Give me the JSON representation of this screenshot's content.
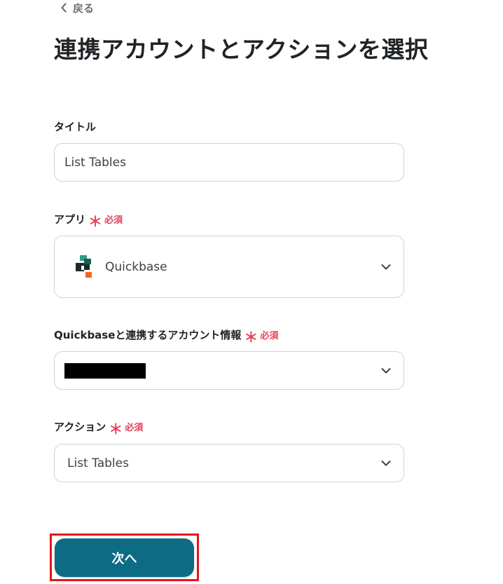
{
  "nav": {
    "back_label": "戻る"
  },
  "page": {
    "title": "連携アカウントとアクションを選択"
  },
  "title_field": {
    "label": "タイトル",
    "value": "List Tables"
  },
  "app_field": {
    "label": "アプリ",
    "required_mark": "＊",
    "required_text": "必須",
    "selected_app": "Quickbase",
    "app_icon": "quickbase-logo"
  },
  "account_field": {
    "label": "Quickbaseと連携するアカウント情報",
    "required_mark": "＊",
    "required_text": "必須"
  },
  "action_field": {
    "label": "アクション",
    "required_mark": "＊",
    "required_text": "必須",
    "selected_action": "List Tables"
  },
  "footer": {
    "next_label": "次へ"
  },
  "colors": {
    "primary": "#0e6b84",
    "required": "#e2445c",
    "highlight": "#e3151c"
  }
}
